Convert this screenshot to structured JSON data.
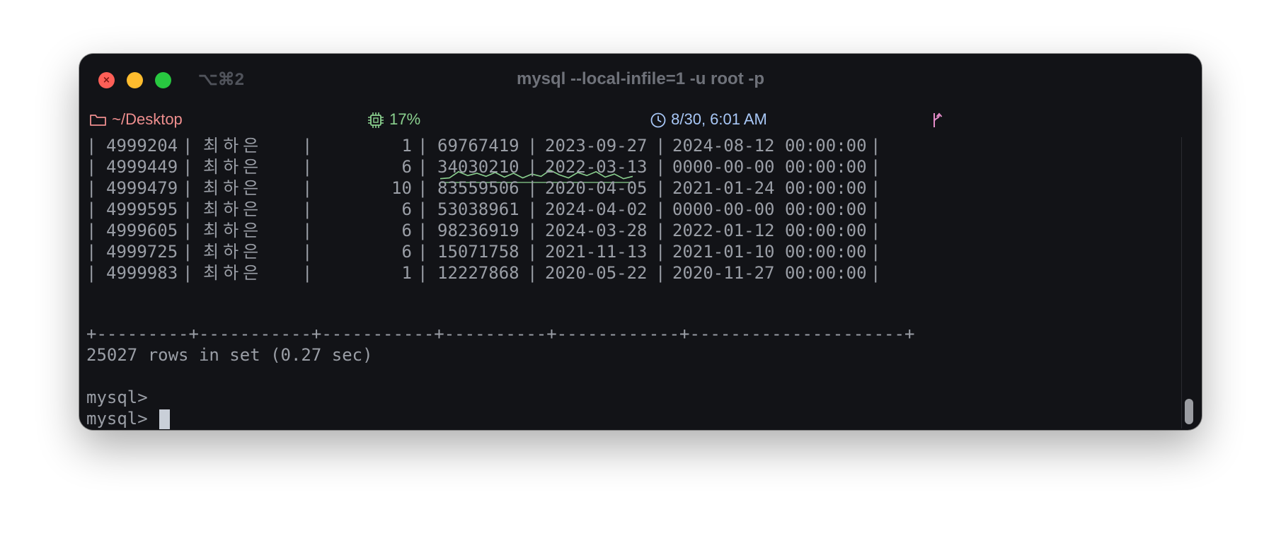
{
  "window": {
    "title": "mysql --local-infile=1 -u root -p",
    "shortcut": "⌥⌘2"
  },
  "statusbar": {
    "directory": "~/Desktop",
    "cpu": "17%",
    "clock": "8/30, 6:01 AM",
    "icons": {
      "directory": "folder-icon",
      "cpu": "cpu-chip-icon",
      "clock": "clock-icon",
      "branch": "git-branch-icon"
    },
    "cpu_sparkline": [
      0.15,
      0.2,
      0.6,
      0.35,
      0.5,
      0.3,
      0.55,
      0.25,
      0.5,
      0.2,
      0.45,
      0.3,
      0.7,
      0.4,
      0.2,
      0.55,
      0.35,
      0.6,
      0.25,
      0.45,
      0.15,
      0.3
    ]
  },
  "colors": {
    "window_bg": "#121317",
    "text": "#9a9ea6",
    "directory": "#ee8e8e",
    "cpu": "#8bd18f",
    "clock": "#a8c7f6",
    "branch": "#e48cc9"
  },
  "table": {
    "rows": [
      [
        "4999204",
        "최하은",
        "1",
        "69767419",
        "2023-09-27",
        "2024-08-12 00:00:00"
      ],
      [
        "4999449",
        "최하은",
        "6",
        "34030210",
        "2022-03-13",
        "0000-00-00 00:00:00"
      ],
      [
        "4999479",
        "최하은",
        "10",
        "83559506",
        "2020-04-05",
        "2021-01-24 00:00:00"
      ],
      [
        "4999595",
        "최하은",
        "6",
        "53038961",
        "2024-04-02",
        "0000-00-00 00:00:00"
      ],
      [
        "4999605",
        "최하은",
        "6",
        "98236919",
        "2024-03-28",
        "2022-01-12 00:00:00"
      ],
      [
        "4999725",
        "최하은",
        "6",
        "15071758",
        "2021-11-13",
        "2021-01-10 00:00:00"
      ],
      [
        "4999983",
        "최하은",
        "1",
        "12227868",
        "2020-05-22",
        "2020-11-27 00:00:00"
      ]
    ],
    "border": "+---------+-----------+-----------+----------+------------+---------------------+"
  },
  "result_summary": "25027 rows in set (0.27 sec)",
  "prompts": [
    "mysql>",
    "mysql>"
  ]
}
